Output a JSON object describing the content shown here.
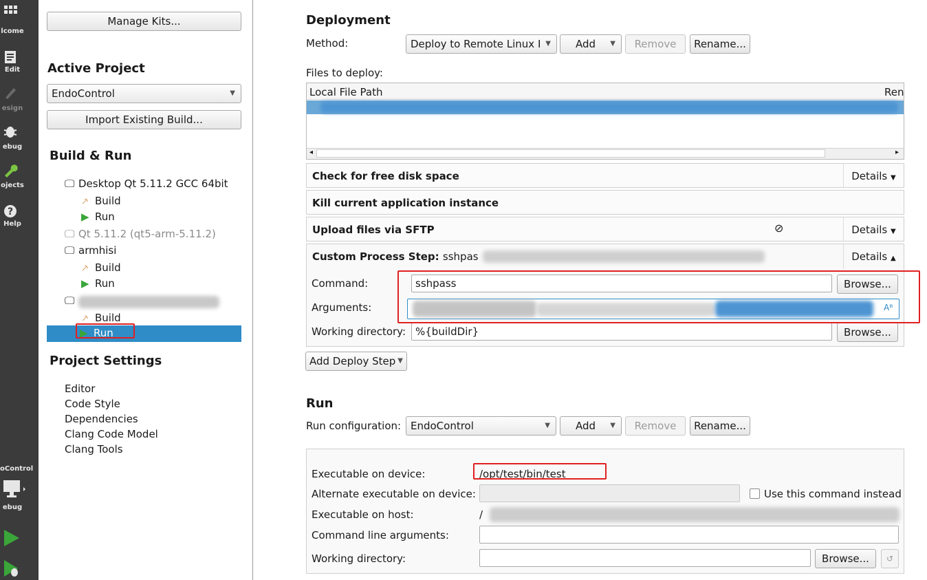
{
  "modebar": {
    "items": [
      {
        "label": "lcome",
        "icon": "grid-icon"
      },
      {
        "label": "Edit",
        "icon": "document-icon"
      },
      {
        "label": "esign",
        "icon": "pencil-icon"
      },
      {
        "label": "ebug",
        "icon": "bug-icon"
      },
      {
        "label": "ojects",
        "icon": "wrench-icon"
      },
      {
        "label": "Help",
        "icon": "help-icon"
      }
    ],
    "kit_label": "oControl",
    "kit_sub": "ebug"
  },
  "project": {
    "manage_kits": "Manage Kits...",
    "active_project_heading": "Active Project",
    "active_project": "EndoControl",
    "import_build": "Import Existing Build...",
    "build_run_heading": "Build & Run",
    "kits": [
      {
        "name": "Desktop Qt 5.11.2 GCC 64bit",
        "build": "Build",
        "run": "Run"
      },
      {
        "name": "Qt 5.11.2 (qt5-arm-5.11.2)"
      },
      {
        "name": "armhisi",
        "build": "Build",
        "run": "Run"
      },
      {
        "name": "",
        "build": "Build",
        "run": "Run"
      }
    ],
    "settings_heading": "Project Settings",
    "settings_items": [
      "Editor",
      "Code Style",
      "Dependencies",
      "Clang Code Model",
      "Clang Tools"
    ]
  },
  "deployment": {
    "title": "Deployment",
    "method_label": "Method:",
    "method_value": "Deploy to Remote Linux I",
    "add": "Add",
    "remove": "Remove",
    "rename": "Rename...",
    "files_label": "Files to deploy:",
    "col_local": "Local File Path",
    "col_remote": "Ren",
    "steps": [
      {
        "title": "Check for free disk space",
        "details": "Details"
      },
      {
        "title": "Kill current application instance"
      },
      {
        "title": "Upload files via SFTP",
        "details": "Details"
      },
      {
        "title": "Custom Process Step:",
        "suffix": "sshpas",
        "details": "Details"
      }
    ],
    "command_label": "Command:",
    "command_value": "sshpass",
    "browse": "Browse...",
    "arguments_label": "Arguments:",
    "workdir_label": "Working directory:",
    "workdir_value": "%{buildDir}",
    "add_deploy_step": "Add Deploy Step"
  },
  "run": {
    "title": "Run",
    "config_label": "Run configuration:",
    "config_value": "EndoControl",
    "add": "Add",
    "remove": "Remove",
    "rename": "Rename...",
    "exec_device_label": "Executable on device:",
    "exec_device_value": "/opt/test/bin/test",
    "alt_exec_label": "Alternate executable on device:",
    "use_command_label": "Use this command instead",
    "exec_host_label": "Executable on host:",
    "exec_host_value": "/",
    "cmd_args_label": "Command line arguments:",
    "workdir_label": "Working directory:",
    "browse": "Browse..."
  },
  "colors": {
    "accent": "#308cc6",
    "highlight": "#e02020",
    "run_green": "#3aa63a"
  }
}
